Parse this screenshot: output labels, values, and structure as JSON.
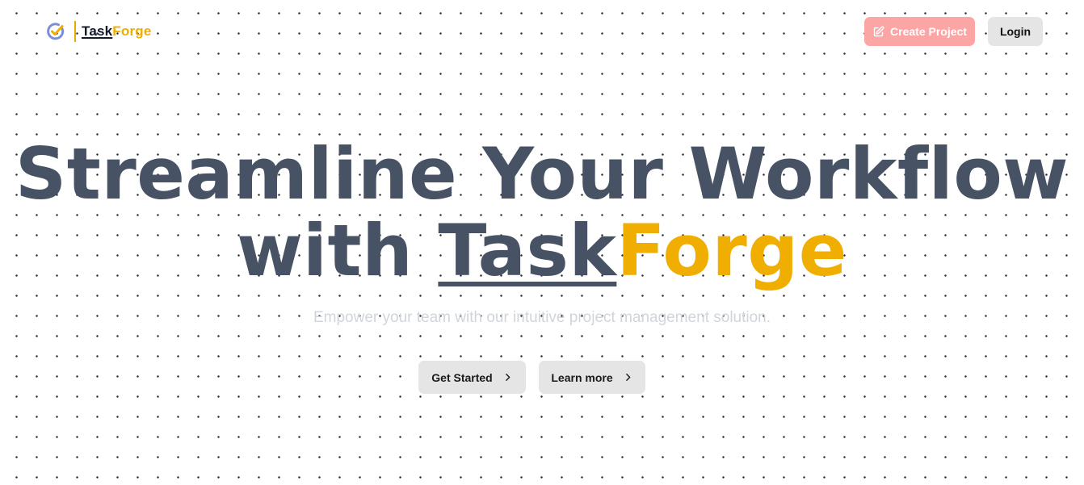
{
  "brand": {
    "name_part1": "Task",
    "name_part2": "Forge",
    "icon": "check-circle-icon",
    "accent_color": "#f0ae00"
  },
  "header": {
    "create_project_label": "Create Project",
    "create_project_icon": "edit-square-icon",
    "login_label": "Login"
  },
  "hero": {
    "title_line1": "Streamline Your Workflow",
    "title_with": "with",
    "title_task": "Task",
    "title_forge": "Forge",
    "subtitle": "Empower your team with our intuitive project management solution.",
    "get_started_label": "Get Started",
    "learn_more_label": "Learn more",
    "cta_icon": "chevron-right-icon"
  },
  "colors": {
    "title": "#475264",
    "create_button_bg": "#fca5a5",
    "secondary_button_bg": "#e5e5e5",
    "subtitle": "#d1d5db"
  }
}
